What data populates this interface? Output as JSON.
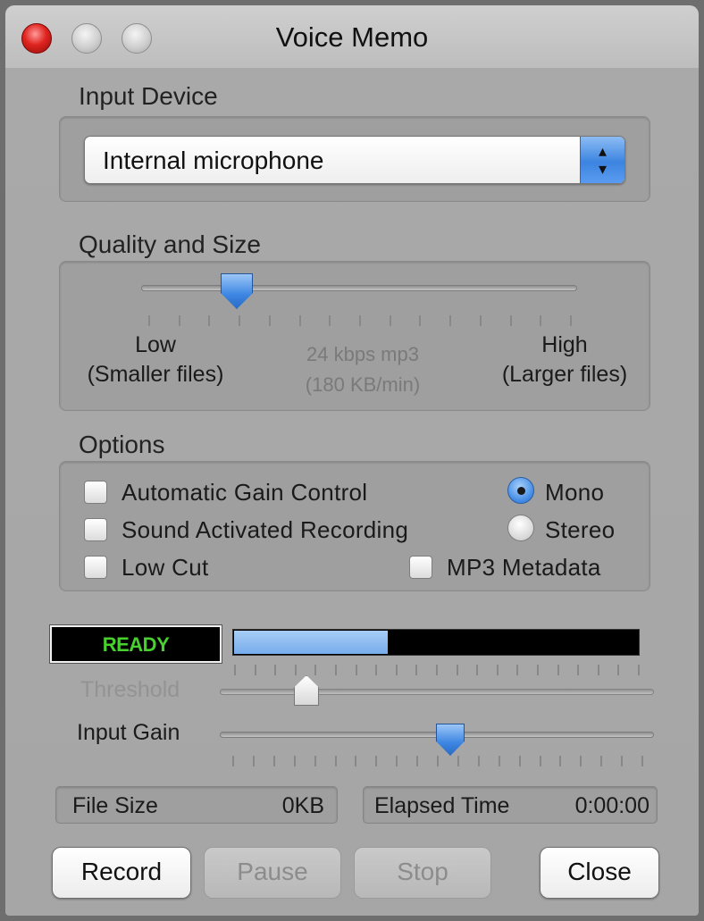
{
  "window": {
    "title": "Voice Memo"
  },
  "input_device": {
    "label": "Input Device",
    "selected": "Internal microphone"
  },
  "quality": {
    "label": "Quality and Size",
    "low_label": "Low",
    "low_sub": "(Smaller files)",
    "high_label": "High",
    "high_sub": "(Larger files)",
    "current": "24 kbps mp3",
    "current_rate": "(180 KB/min)",
    "level": 0.22
  },
  "options": {
    "label": "Options",
    "automatic_gain_control": {
      "label": "Automatic Gain Control",
      "checked": false
    },
    "sound_activated_recording": {
      "label": "Sound Activated Recording",
      "checked": false
    },
    "low_cut": {
      "label": "Low Cut",
      "checked": false
    },
    "mp3_metadata": {
      "label": "MP3 Metadata",
      "checked": false
    },
    "channels": {
      "mono": "Mono",
      "stereo": "Stereo",
      "selected": "mono"
    }
  },
  "meter": {
    "status": "READY",
    "level": 0.38,
    "threshold_label": "Threshold",
    "threshold": 0.2,
    "input_gain_label": "Input Gain",
    "input_gain": 0.53
  },
  "file_size": {
    "label": "File Size",
    "value": "0KB"
  },
  "elapsed_time": {
    "label": "Elapsed Time",
    "value": "0:00:00"
  },
  "buttons": {
    "record": "Record",
    "pause": "Pause",
    "stop": "Stop",
    "close": "Close"
  },
  "colors": {
    "status_green": "#48d12e",
    "accent_blue": "#3d86e2",
    "close_red": "#e0241f"
  }
}
